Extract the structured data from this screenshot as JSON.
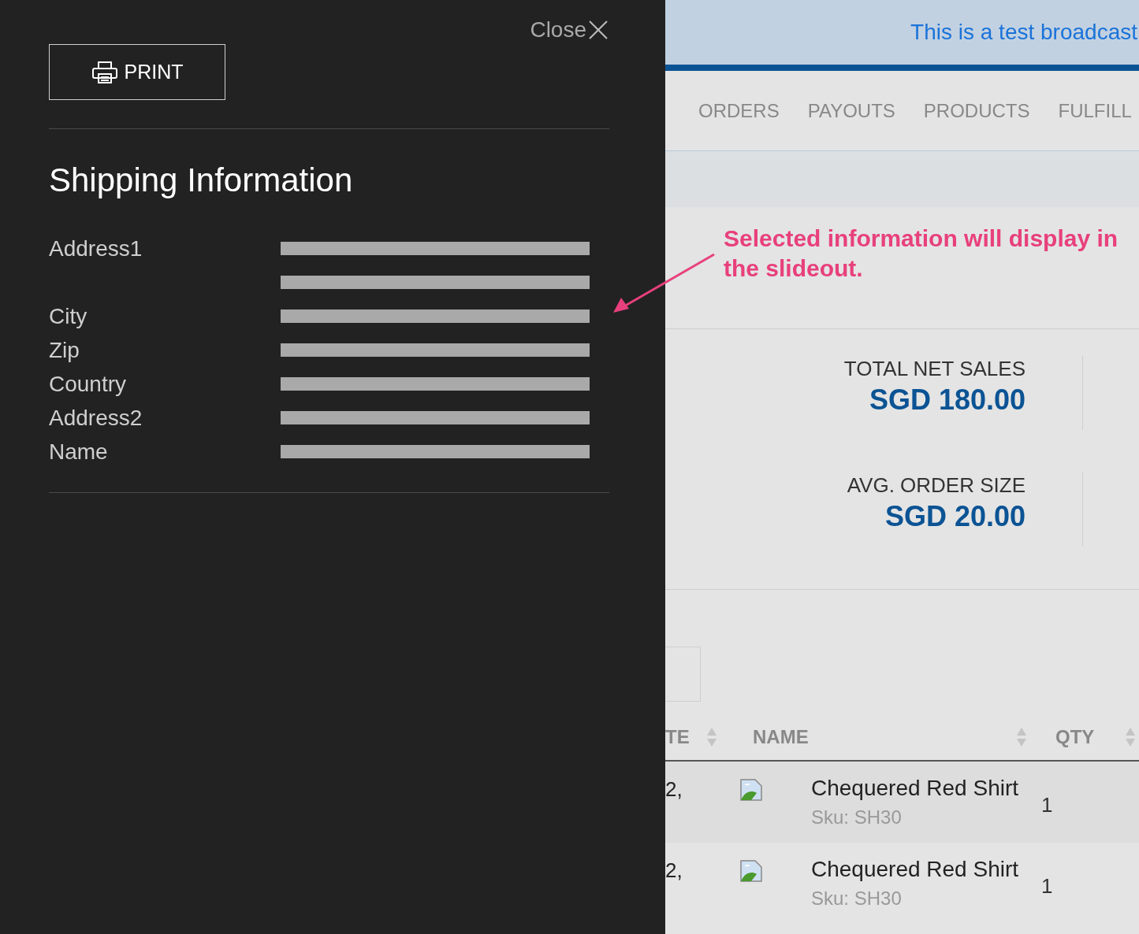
{
  "slideout": {
    "close_label": "Close",
    "print_label": "PRINT",
    "title": "Shipping Information",
    "fields": [
      {
        "label": "Address1",
        "value_lines": [
          {
            "kind": "redacted"
          },
          {
            "kind": "redacted"
          }
        ]
      },
      {
        "label": "City",
        "value_lines": [
          {
            "kind": "redacted"
          }
        ]
      },
      {
        "label": "Zip",
        "value_lines": [
          {
            "kind": "redacted"
          }
        ]
      },
      {
        "label": "Country",
        "value_lines": [
          {
            "kind": "redacted"
          }
        ]
      },
      {
        "label": "Address2",
        "value_lines": [
          {
            "kind": "redacted"
          }
        ]
      },
      {
        "label": "Name",
        "value_lines": [
          {
            "kind": "redacted"
          }
        ]
      }
    ]
  },
  "broadcast": "This is a test broadcast",
  "nav_tabs": [
    {
      "label": "ORDERS",
      "selected": false
    },
    {
      "label": "PAYOUTS",
      "selected": false
    },
    {
      "label": "PRODUCTS",
      "selected": false
    },
    {
      "label": "FULFILL",
      "selected": false
    }
  ],
  "annotation": "Selected information will display in the slideout.",
  "stats": [
    {
      "label": "TOTAL NET SALES",
      "value": "SGD 180.00"
    },
    {
      "label": "AVG. ORDER SIZE",
      "value": "SGD 20.00"
    }
  ],
  "table": {
    "columns": [
      "TE",
      "NAME",
      "QTY"
    ],
    "rows": [
      {
        "column_1": "2,",
        "name": "Chequered Red Shirt",
        "sku": "Sku: SH30",
        "qty": "1"
      },
      {
        "column_1": "2,",
        "name": "Chequered Red Shirt",
        "sku": "Sku: SH30",
        "qty": "1"
      }
    ]
  }
}
